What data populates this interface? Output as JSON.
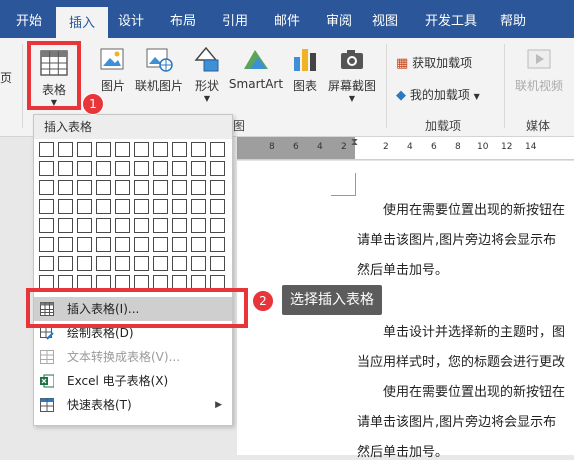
{
  "tabs": [
    "开始",
    "插入",
    "设计",
    "布局",
    "引用",
    "邮件",
    "审阅",
    "视图",
    "开发工具",
    "帮助"
  ],
  "ribbon": {
    "left_cut": "页",
    "table": "表格",
    "picture": "图片",
    "online_picture": "联机图片",
    "shapes": "形状",
    "smartart": "SmartArt",
    "chart": "图表",
    "screenshot": "屏幕截图",
    "get_addins": "获取加载项",
    "my_addins": "我的加载项",
    "online_video": "联机视频",
    "group_illustrations_cut": "图",
    "group_addins": "加载项",
    "group_media": "媒体"
  },
  "ruler_ticks_left": [
    "8",
    "6",
    "4",
    "2"
  ],
  "ruler_ticks_right": [
    "2",
    "4",
    "6",
    "8",
    "10",
    "12",
    "14"
  ],
  "document": {
    "lines": [
      "使用在需要位置出现的新按钮在",
      "请单击该图片,图片旁边将会显示布",
      "然后单击加号。",
      "单击设计并选择新的主题时，图",
      "当应用样式时，您的标题会进行更改",
      "使用在需要位置出现的新按钮在",
      "请单击该图片,图片旁边将会显示布",
      "然后单击加号。"
    ]
  },
  "dropdown": {
    "header": "插入表格",
    "items": [
      {
        "label": "插入表格(I)...",
        "disabled": false,
        "icon": "table-icon"
      },
      {
        "label": "绘制表格(D)",
        "disabled": false,
        "icon": "pencil-table-icon"
      },
      {
        "label": "文本转换成表格(V)...",
        "disabled": true,
        "icon": "text-to-table-icon"
      },
      {
        "label": "Excel 电子表格(X)",
        "disabled": false,
        "icon": "excel-icon"
      },
      {
        "label": "快速表格(T)",
        "disabled": false,
        "icon": "quick-table-icon"
      }
    ]
  },
  "annotations": {
    "step1": "1",
    "step2": "2",
    "callout": "选择插入表格"
  },
  "colors": {
    "ribbon_blue": "#2b579a",
    "highlight_red": "#e8353a"
  }
}
